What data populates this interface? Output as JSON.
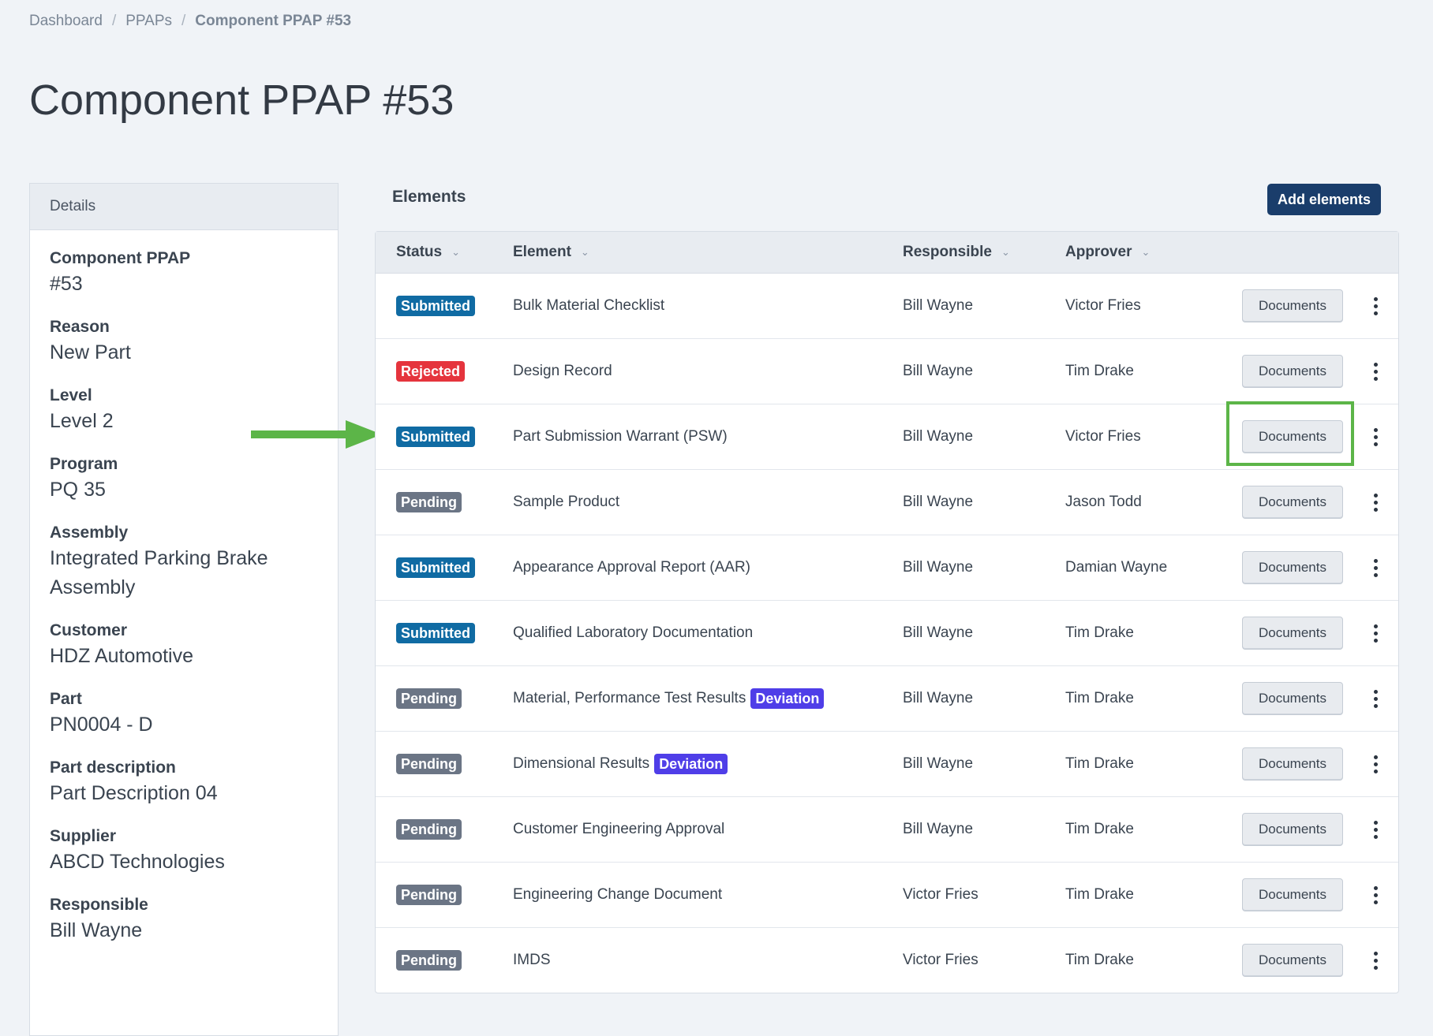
{
  "breadcrumb": {
    "items": [
      "Dashboard",
      "PPAPs"
    ],
    "current": "Component PPAP #53"
  },
  "page_title": "Component PPAP #53",
  "details": {
    "header": "Details",
    "fields": [
      {
        "label": "Component PPAP",
        "value": "#53"
      },
      {
        "label": "Reason",
        "value": "New Part"
      },
      {
        "label": "Level",
        "value": "Level 2"
      },
      {
        "label": "Program",
        "value": "PQ 35"
      },
      {
        "label": "Assembly",
        "value": "Integrated Parking Brake Assembly"
      },
      {
        "label": "Customer",
        "value": "HDZ Automotive"
      },
      {
        "label": "Part",
        "value": "PN0004 - D"
      },
      {
        "label": "Part description",
        "value": "Part Description 04"
      },
      {
        "label": "Supplier",
        "value": "ABCD Technologies"
      },
      {
        "label": "Responsible",
        "value": "Bill Wayne"
      }
    ]
  },
  "elements": {
    "title": "Elements",
    "add_button": "Add elements",
    "columns": {
      "status": "Status",
      "element": "Element",
      "responsible": "Responsible",
      "approver": "Approver"
    },
    "documents_label": "Documents",
    "rows": [
      {
        "status": "Submitted",
        "element": "Bulk Material Checklist",
        "deviation": "",
        "responsible": "Bill Wayne",
        "approver": "Victor Fries"
      },
      {
        "status": "Rejected",
        "element": "Design Record",
        "deviation": "",
        "responsible": "Bill Wayne",
        "approver": "Tim Drake"
      },
      {
        "status": "Submitted",
        "element": "Part Submission Warrant (PSW)",
        "deviation": "",
        "responsible": "Bill Wayne",
        "approver": "Victor Fries"
      },
      {
        "status": "Pending",
        "element": "Sample Product",
        "deviation": "",
        "responsible": "Bill Wayne",
        "approver": "Jason Todd"
      },
      {
        "status": "Submitted",
        "element": "Appearance Approval Report (AAR)",
        "deviation": "",
        "responsible": "Bill Wayne",
        "approver": "Damian Wayne"
      },
      {
        "status": "Submitted",
        "element": "Qualified Laboratory Documentation",
        "deviation": "",
        "responsible": "Bill Wayne",
        "approver": "Tim Drake"
      },
      {
        "status": "Pending",
        "element": "Material, Performance Test Results",
        "deviation": "Deviation",
        "responsible": "Bill Wayne",
        "approver": "Tim Drake"
      },
      {
        "status": "Pending",
        "element": "Dimensional Results",
        "deviation": "Deviation",
        "responsible": "Bill Wayne",
        "approver": "Tim Drake"
      },
      {
        "status": "Pending",
        "element": "Customer Engineering Approval",
        "deviation": "",
        "responsible": "Bill Wayne",
        "approver": "Tim Drake"
      },
      {
        "status": "Pending",
        "element": "Engineering Change Document",
        "deviation": "",
        "responsible": "Victor Fries",
        "approver": "Tim Drake"
      },
      {
        "status": "Pending",
        "element": "IMDS",
        "deviation": "",
        "responsible": "Victor Fries",
        "approver": "Tim Drake"
      }
    ]
  },
  "annotations": {
    "arrow_color": "#5cb548",
    "highlight_color": "#5cb548",
    "highlighted_row": 2
  },
  "colors": {
    "submitted": "#106ba3",
    "rejected": "#e5343d",
    "pending": "#6b7585",
    "deviation": "#4f3ee8",
    "primary": "#1a3d6b"
  }
}
